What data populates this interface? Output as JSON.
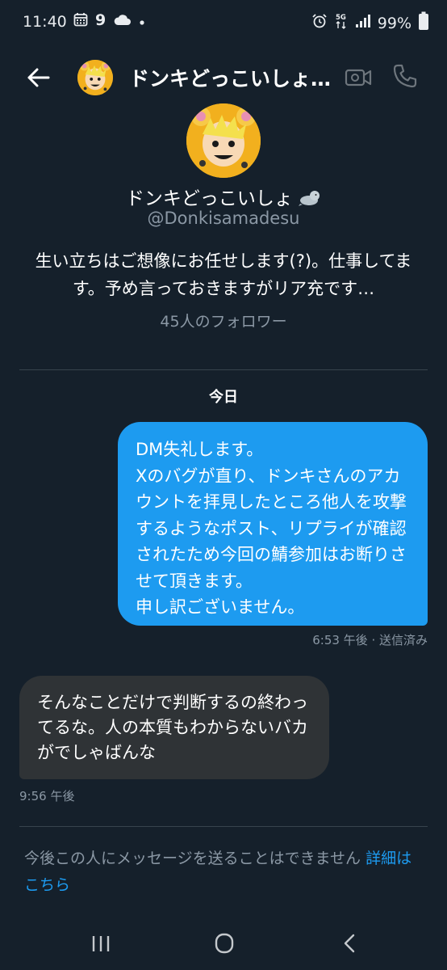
{
  "status_bar": {
    "time": "11:40",
    "battery": "99%",
    "network": "5G",
    "icons": [
      "calendar-icon",
      "nine-badge-icon",
      "cloud-icon",
      "dot-icon",
      "alarm-icon",
      "network-5g-icon",
      "signal-icon",
      "battery-icon"
    ]
  },
  "header": {
    "title": "ドンキどっこいしょ…",
    "icons": [
      "back-arrow-icon",
      "video-call-icon",
      "phone-call-icon"
    ]
  },
  "profile": {
    "name": "ドンキどっこいしょ",
    "name_emoji": "seal-emoji-icon",
    "handle": "@Donkisamadesu",
    "bio": "生い立ちはご想像にお任せします(?)。仕事してます。予め言っておきますがリア充です…",
    "followers": "45人のフォロワー"
  },
  "conversation": {
    "date_label": "今日",
    "messages": [
      {
        "direction": "outgoing",
        "text": "DM失礼します。\nXのバグが直り、ドンキさんのアカウントを拝見したところ他人を攻撃するようなポスト、リプライが確認されたため今回の鯖参加はお断りさせて頂きます。\n申し訳ございません。",
        "meta": "6:53 午後 · 送信済み"
      },
      {
        "direction": "incoming",
        "text": "そんなことだけで判断するの終わってるな。人の本質もわからないバカがでしゃばんな",
        "meta": "9:56 午後"
      }
    ]
  },
  "footer_notice": {
    "text": "今後この人にメッセージを送ることはできません",
    "link": "詳細はこちら"
  },
  "colors": {
    "background": "#15202b",
    "accent": "#1d9bf0",
    "incoming_bubble": "#2f3336",
    "secondary_text": "#8b98a5"
  },
  "nav_bar": {
    "icons": [
      "recent-apps-icon",
      "home-icon",
      "back-icon"
    ]
  }
}
